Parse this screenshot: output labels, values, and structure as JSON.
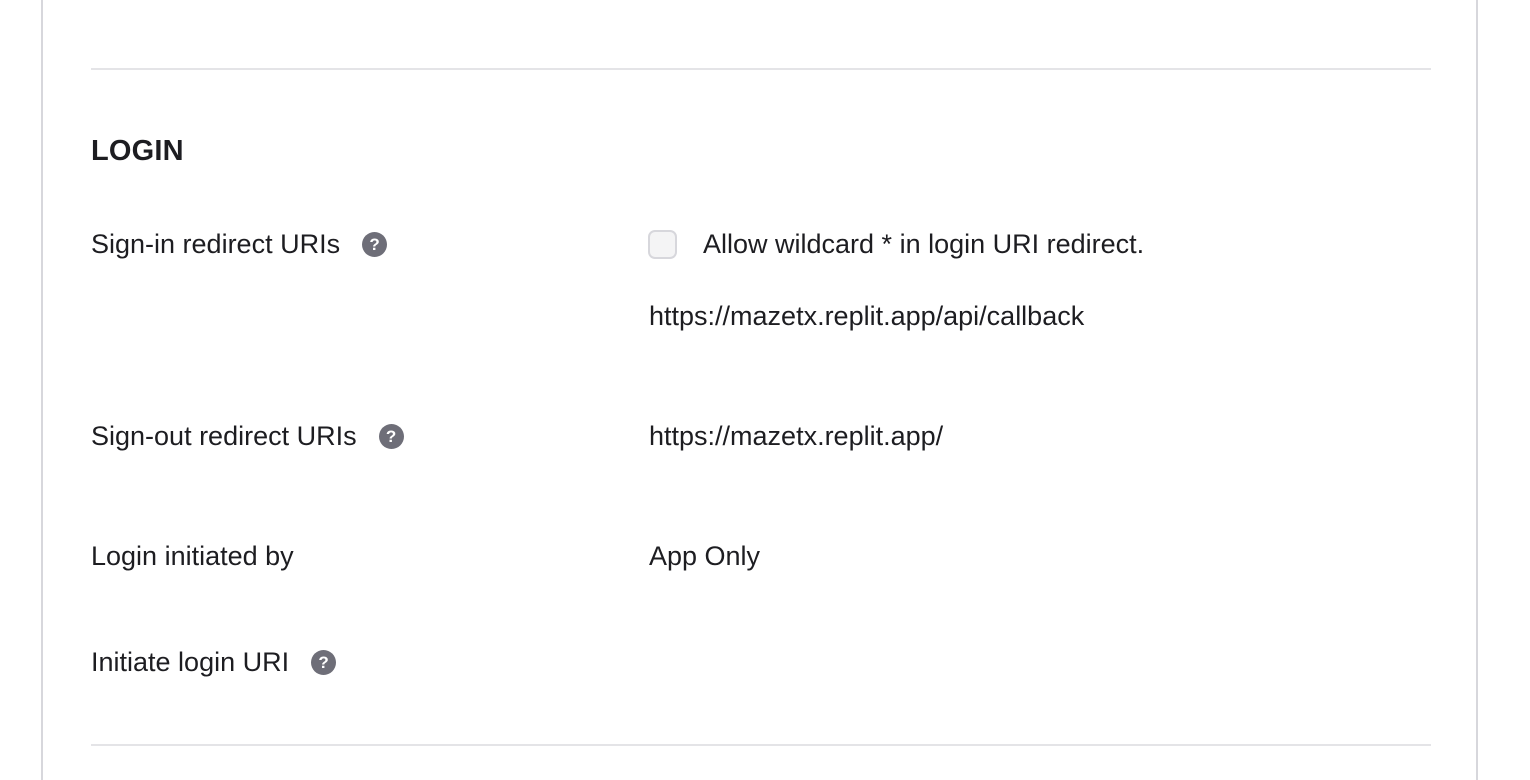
{
  "section": {
    "title": "LOGIN"
  },
  "rows": {
    "sign_in": {
      "label": "Sign-in redirect URIs",
      "help_icon": "question-circle-icon",
      "wildcard_checkbox": {
        "label": "Allow wildcard * in login URI redirect.",
        "checked": false
      },
      "uri": "https://mazetx.replit.app/api/callback"
    },
    "sign_out": {
      "label": "Sign-out redirect URIs",
      "help_icon": "question-circle-icon",
      "uri": "https://mazetx.replit.app/"
    },
    "initiated_by": {
      "label": "Login initiated by",
      "value": "App Only"
    },
    "initiate_uri": {
      "label": "Initiate login URI",
      "help_icon": "question-circle-icon",
      "value": ""
    }
  },
  "icons": {
    "help_glyph": "?"
  },
  "colors": {
    "text": "#1d1d21",
    "help_icon_bg": "#6e6e78",
    "divider": "#e4e4e7",
    "panel_border": "#d7d7dc"
  }
}
